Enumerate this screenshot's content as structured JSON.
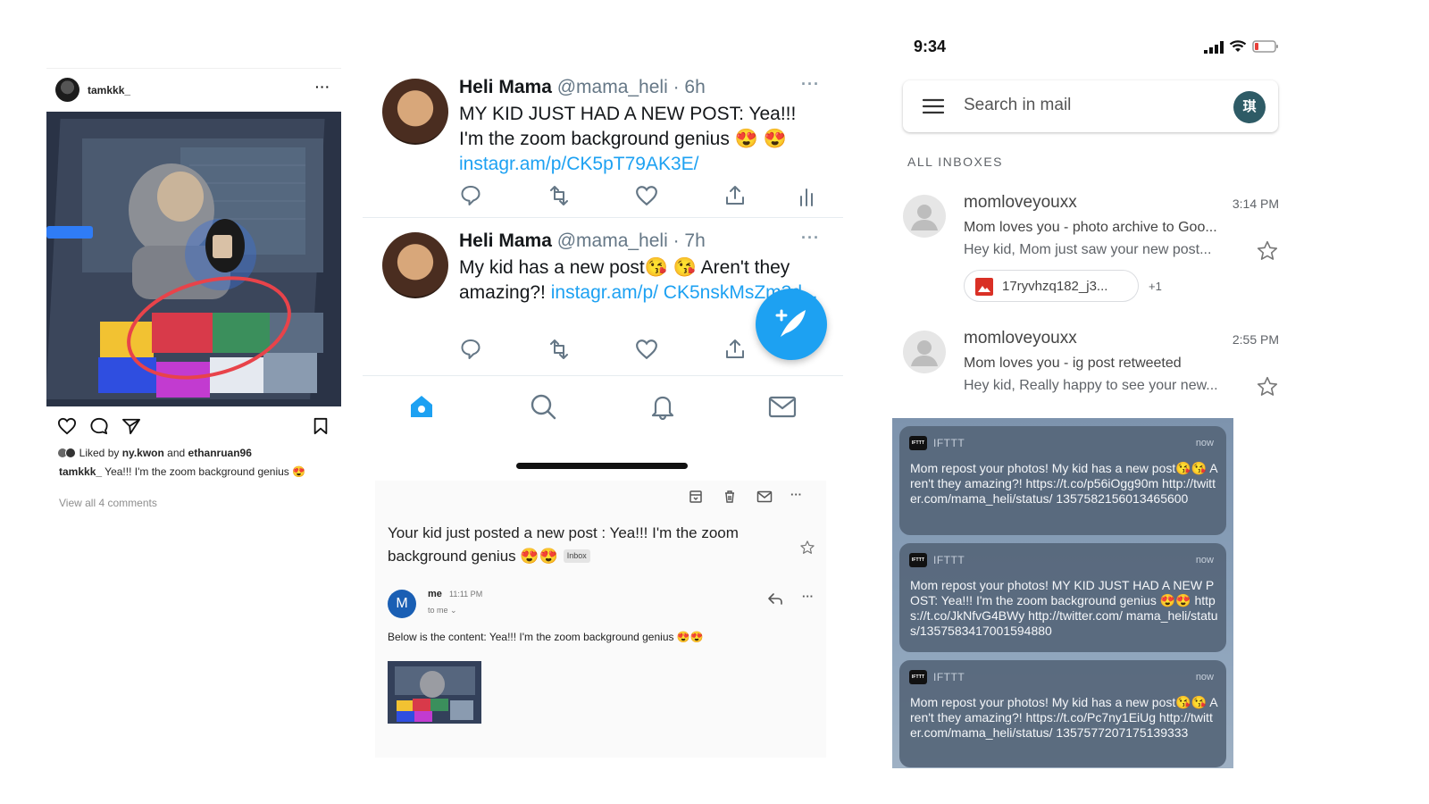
{
  "instagram": {
    "username": "tamkkk_",
    "more": "···",
    "liked_by_prefix": "Liked by ",
    "liked_by_user1": "ny.kwon",
    "liked_by_and": " and ",
    "liked_by_user2": "ethanruan96",
    "caption_user": "tamkkk_",
    "caption_text": " Yea!!! I'm the zoom background genius 😍",
    "view_comments": "View all 4 comments"
  },
  "twitter": {
    "tweets": [
      {
        "name": "Heli Mama",
        "handle": " @mama_heli · 6h",
        "text": "MY KID JUST HAD A NEW POST: Yea!!! I'm the zoom background genius 😍 😍",
        "link": "instagr.am/p/CK5pT79AK3E/"
      },
      {
        "name": "Heli Mama",
        "handle": " @mama_heli · 7h",
        "text": "My kid has a new post😘 😘 Aren't they amazing?! ",
        "link": "instagr.am/p/ CK5nskMsZm3d..."
      }
    ],
    "more": "···"
  },
  "email": {
    "subject": "Your kid just posted a new post : Yea!!! I'm the zoom background genius 😍😍",
    "inbox_label": "Inbox",
    "avatar_letter": "M",
    "from": "me",
    "time": "11:11 PM",
    "to": "to me ⌄",
    "more": "···",
    "body": "Below is the content: Yea!!! I'm the zoom background genius 😍😍"
  },
  "phone": {
    "time": "9:34",
    "search_placeholder": "Search in mail",
    "account_avatar": "琪",
    "inbox_heading": "ALL INBOXES",
    "mails": [
      {
        "sender": "momloveyouxx",
        "time": "3:14 PM",
        "subject": "Mom loves you - photo archive to Goo...",
        "snippet": "Hey kid, Mom just saw your new post...",
        "attachment": "17ryvhzq182_j3...",
        "attachment_more": "+1"
      },
      {
        "sender": "momloveyouxx",
        "time": "2:55 PM",
        "subject": "Mom loves you - ig post retweeted",
        "snippet": "Hey kid, Really happy to see your new..."
      }
    ]
  },
  "notifications": [
    {
      "app": "IFTTT",
      "time": "now",
      "logo": "IFTTT",
      "body": "Mom repost your photos! My kid has a new post😘😘 Aren't they amazing?! https://t.co/p56iOgg90m http://twitter.com/mama_heli/status/ 1357582156013465600"
    },
    {
      "app": "IFTTT",
      "time": "now",
      "logo": "IFTTT",
      "body": "Mom repost your photos! MY KID JUST HAD A NEW POST: Yea!!! I'm the zoom background genius 😍😍 https://t.co/JkNfvG4BWy http://twitter.com/ mama_heli/status/1357583417001594880"
    },
    {
      "app": "IFTTT",
      "time": "now",
      "logo": "IFTTT",
      "body": "Mom repost your photos! My kid has a new post😘😘 Aren't they amazing?! https://t.co/Pc7ny1EiUg http://twitter.com/mama_heli/status/ 1357577207175139333"
    }
  ],
  "colors": {
    "twitter_blue": "#1da1f2",
    "gmail_red": "#d93025",
    "notification_bg": "#56667a"
  }
}
